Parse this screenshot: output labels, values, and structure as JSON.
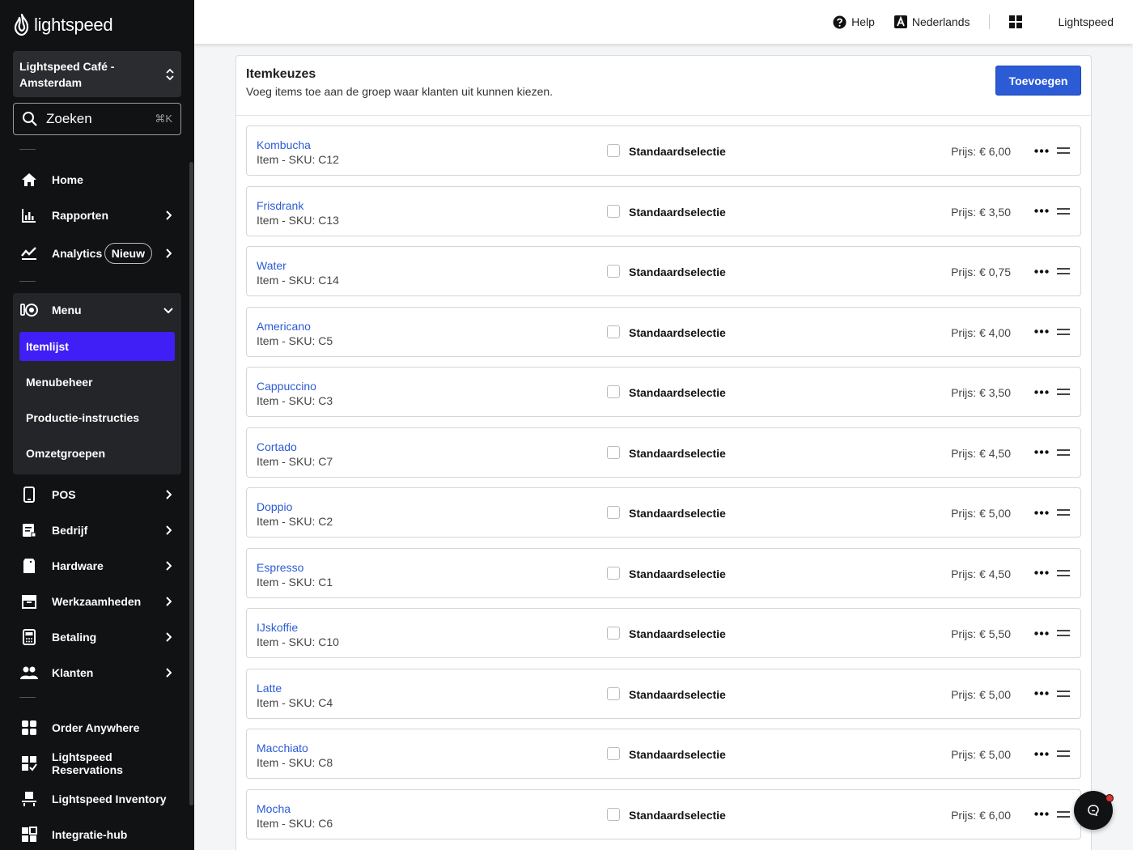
{
  "brand": {
    "name": "lightspeed"
  },
  "sidebar": {
    "store": "Lightspeed Café - Amsterdam",
    "search": {
      "placeholder": "Zoeken",
      "shortcut": "⌘K"
    },
    "nav": {
      "home": "Home",
      "rapporten": "Rapporten",
      "analytics": "Analytics",
      "analytics_badge": "Nieuw",
      "menu": "Menu",
      "pos": "POS",
      "bedrijf": "Bedrijf",
      "hardware": "Hardware",
      "werkzaamheden": "Werkzaamheden",
      "betaling": "Betaling",
      "klanten": "Klanten",
      "order_anywhere": "Order Anywhere",
      "reservations": "Lightspeed Reservations",
      "inventory": "Lightspeed Inventory",
      "integratie": "Integratie-hub"
    },
    "menu_sub": [
      "Itemlijst",
      "Menubeheer",
      "Productie-instructies",
      "Omzetgroepen"
    ],
    "active_sub": "Itemlijst"
  },
  "topbar": {
    "help": "Help",
    "language": "Nederlands",
    "account": "Lightspeed"
  },
  "panel": {
    "title": "Itemkeuzes",
    "subtitle": "Voeg items toe aan de groep waar klanten uit kunnen kiezen.",
    "add_button": "Toevoegen",
    "default_label": "Standaardselectie",
    "items": [
      {
        "name": "Kombucha",
        "sku": "Item - SKU: C12",
        "price": "Prijs: € 6,00"
      },
      {
        "name": "Frisdrank",
        "sku": "Item - SKU: C13",
        "price": "Prijs: € 3,50"
      },
      {
        "name": "Water",
        "sku": "Item - SKU: C14",
        "price": "Prijs: € 0,75"
      },
      {
        "name": "Americano",
        "sku": "Item - SKU: C5",
        "price": "Prijs: € 4,00"
      },
      {
        "name": "Cappuccino",
        "sku": "Item - SKU: C3",
        "price": "Prijs: € 3,50"
      },
      {
        "name": "Cortado",
        "sku": "Item - SKU: C7",
        "price": "Prijs: € 4,50"
      },
      {
        "name": "Doppio",
        "sku": "Item - SKU: C2",
        "price": "Prijs: € 5,00"
      },
      {
        "name": "Espresso",
        "sku": "Item - SKU: C1",
        "price": "Prijs: € 4,50"
      },
      {
        "name": "IJskoffie",
        "sku": "Item - SKU: C10",
        "price": "Prijs: € 5,50"
      },
      {
        "name": "Latte",
        "sku": "Item - SKU: C4",
        "price": "Prijs: € 5,00"
      },
      {
        "name": "Macchiato",
        "sku": "Item - SKU: C8",
        "price": "Prijs: € 5,00"
      },
      {
        "name": "Mocha",
        "sku": "Item - SKU: C6",
        "price": "Prijs: € 6,00"
      }
    ]
  },
  "colors": {
    "accent": "#3f1ff5",
    "link": "#2c5bd6",
    "sidebar_bg": "#111213"
  }
}
